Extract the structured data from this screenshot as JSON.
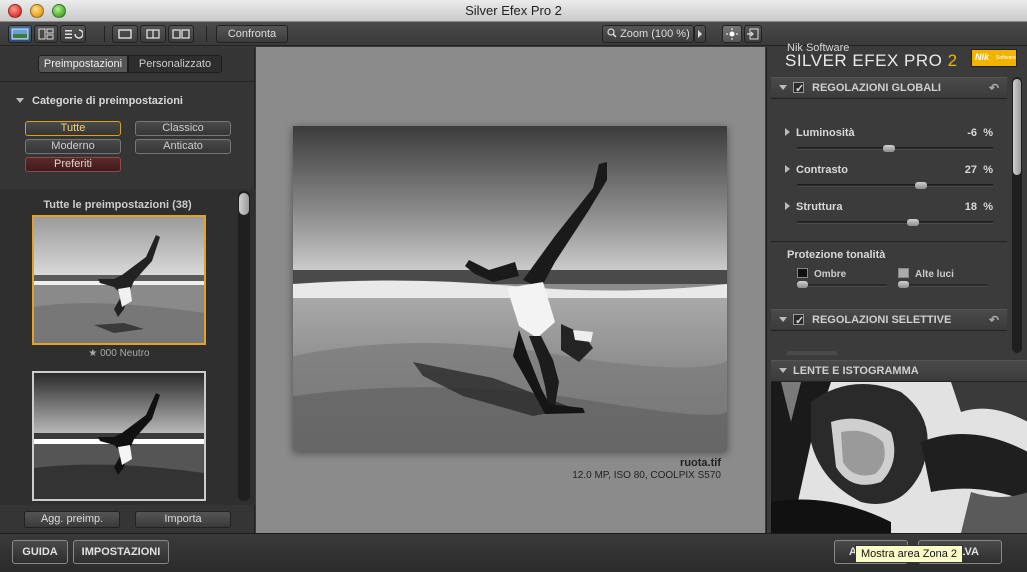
{
  "window": {
    "title": "Silver Efex Pro 2"
  },
  "toolbar": {
    "compare_label": "Confronta",
    "zoom_label": "Zoom (100 %)",
    "icons": [
      "single-view-icon",
      "split-view-icon",
      "history-icon",
      "full-view-icon",
      "split-vertical-icon",
      "side-by-side-icon",
      "search-icon",
      "chevron-right-icon",
      "loupe-icon",
      "export-icon"
    ]
  },
  "left": {
    "tabs": [
      {
        "label": "Preimpostazioni",
        "active": true
      },
      {
        "label": "Personalizzato",
        "active": false
      }
    ],
    "categories_title": "Categorie di preimpostazioni",
    "categories": [
      {
        "label": "Tutte",
        "selected": true
      },
      {
        "label": "Classico"
      },
      {
        "label": "Moderno"
      },
      {
        "label": "Anticato"
      },
      {
        "label": "Preferiti",
        "favorite": true
      }
    ],
    "list_title": "Tutte le preimpostazioni (38)",
    "presets": [
      {
        "label": "000 Neutro",
        "star": "★"
      }
    ],
    "add_preset_label": "Agg. preimp.",
    "import_label": "Importa"
  },
  "center": {
    "file_name": "ruota.tif",
    "file_info": "12.0 MP, ISO 80, COOLPIX S570"
  },
  "right": {
    "brand_small": "Nik Software",
    "brand_name": "SILVER EFEX PRO",
    "brand_version": "2",
    "brand_logo_text": "Nik",
    "brand_logo_sub": "Software",
    "global_title": "REGOLAZIONI GLOBALI",
    "sliders": [
      {
        "label": "Luminosità",
        "value": "-6",
        "unit": "%",
        "pos": 47
      },
      {
        "label": "Contrasto",
        "value": "27",
        "unit": "%",
        "pos": 63.5
      },
      {
        "label": "Struttura",
        "value": "18",
        "unit": "%",
        "pos": 59
      }
    ],
    "tonal_title": "Protezione tonalità",
    "shadows_label": "Ombre",
    "highlights_label": "Alte luci",
    "selective_title": "REGOLAZIONI SELETTIVE",
    "lens_title": "LENTE E ISTOGRAMMA"
  },
  "bottom": {
    "help_label": "GUIDA",
    "settings_label": "IMPOSTAZIONI",
    "cancel_label": "A",
    "save_label": "ALVA",
    "tooltip": "Mostra area Zona 2"
  }
}
